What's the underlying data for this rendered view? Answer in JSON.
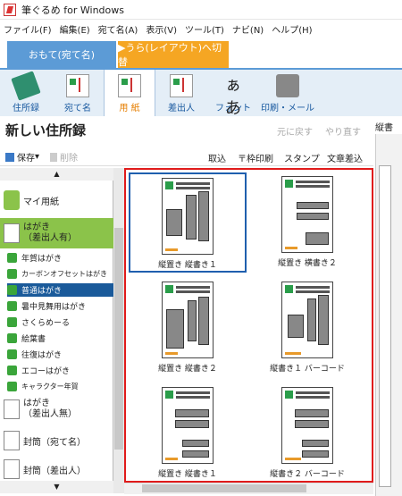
{
  "window": {
    "title": "筆ぐるめ for Windows"
  },
  "menu": [
    "ファイル(F)",
    "編集(E)",
    "宛て名(A)",
    "表示(V)",
    "ツール(T)",
    "ナビ(N)",
    "ヘルプ(H)"
  ],
  "tabs": {
    "front": "おもて(宛て名)",
    "back": "▶うら(レイアウト)へ切替"
  },
  "toolbar": [
    "住所録",
    "宛て名",
    "用 紙",
    "差出人",
    "フォント",
    "印刷・メール"
  ],
  "pane": {
    "title": "新しい住所録",
    "undo": "元に戻す",
    "redo": "やり直す",
    "right_label": "縦書"
  },
  "actions": {
    "save": "保存",
    "delete": "削除",
    "import": "取込",
    "frame_print": "〒枠印刷",
    "stamp": "スタンプ",
    "insert_text": "文章差込"
  },
  "sidebar": {
    "categories": [
      "マイ用紙",
      "はがき\n（差出人有）",
      "はがき\n（差出人無）",
      "封筒（宛て名）",
      "封筒（差出人）"
    ],
    "items": [
      "年賀はがき",
      "カーボンオフセットはがき",
      "普通はがき",
      "暑中見舞用はがき",
      "さくらめーる",
      "絵葉書",
      "往復はがき",
      "エコーはがき",
      "キャラクター年賀"
    ]
  },
  "layouts": [
    "縦置き 縦書き１",
    "縦置き 横書き２",
    "縦置き 縦書き２",
    "縦書き１ バーコード",
    "縦置き 縦書き１",
    "縦書き２ バーコード"
  ],
  "colors": {
    "accent": "#5c9bd6",
    "back_tab": "#f5a623",
    "selected_category": "#8bc34a",
    "selected_item": "#1a5a9a",
    "grid_border": "#e01b1b"
  }
}
